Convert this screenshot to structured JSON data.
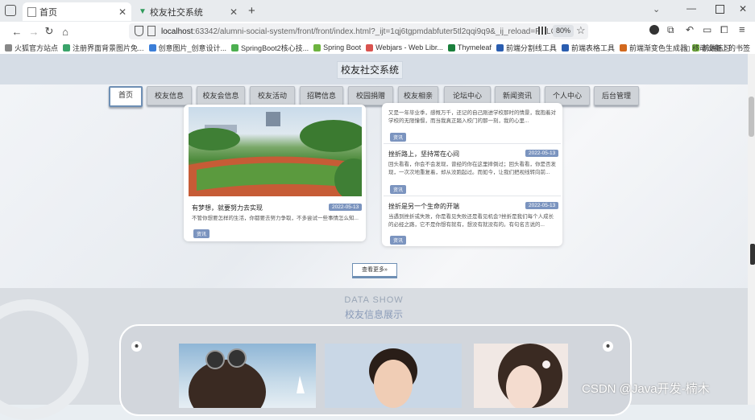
{
  "browser": {
    "tabs": [
      {
        "title": "首页",
        "active": true
      },
      {
        "title": "校友社交系统",
        "active": false
      }
    ],
    "url_host": "localhost",
    "url_rest": ":63342/alumni-social-system/front/front/index.html?_ijt=1qj6tgpmdabfuter5tl2qqi9q9&_ij_reload=RELOAD",
    "zoom": "80%",
    "bookmarks": [
      "火狐官方站点",
      "注册界面背景图片免...",
      "创意图片_创意设计...",
      "SpringBoot2核心技...",
      "Spring Boot",
      "Webjars - Web Libr...",
      "Thymeleaf",
      "前端分割线工具",
      "前端表格工具",
      "前端渐变色生成器",
      "前端练习"
    ],
    "bookmark_right": "移动设备上的书签"
  },
  "site": {
    "title": "校友社交系统",
    "nav": [
      "首页",
      "校友信息",
      "校友会信息",
      "校友活动",
      "招聘信息",
      "校园捐赠",
      "校友相亲",
      "论坛中心",
      "新闻资讯",
      "个人中心",
      "后台管理"
    ]
  },
  "news": {
    "featured": {
      "title": "有梦想，就要努力去实现",
      "date": "2022-05-13",
      "excerpt": "不管你想要怎样的生活，你都要去努力争取，不多尝试一些事情怎么知...",
      "tag": "资讯"
    },
    "top_partial": {
      "excerpt": "又是一年毕业季，感慨万千，还记的自己刚进学校那时的情景，我抱着对学校的无限憧憬，而当我真正踏入校门的那一刻，我的心里...",
      "tag": "资讯"
    },
    "items": [
      {
        "title": "挫折路上，坚持常在心间",
        "date": "2022-05-13",
        "excerpt": "回头看看，你会不会发现，曾经的你在这里摔倒过；回头看看，你是否发现，一次次地重复着，却从没跑起过。而如今，让我们把视线转向前...",
        "tag": "资讯"
      },
      {
        "title": "挫折是另一个生命的开端",
        "date": "2022-05-13",
        "excerpt": "当遇到挫折或失败，你是看见失败还是看见机会?挫折是我们每个人成长的必经之路，它不是你想有就有，想没有就没有的。有句名言说的...",
        "tag": "资讯"
      }
    ],
    "more_label": "查看更多»"
  },
  "data_show": {
    "title_en": "DATA SHOW",
    "title_cn": "校友信息展示"
  },
  "watermark": "CSDN @Java开发-楠木"
}
